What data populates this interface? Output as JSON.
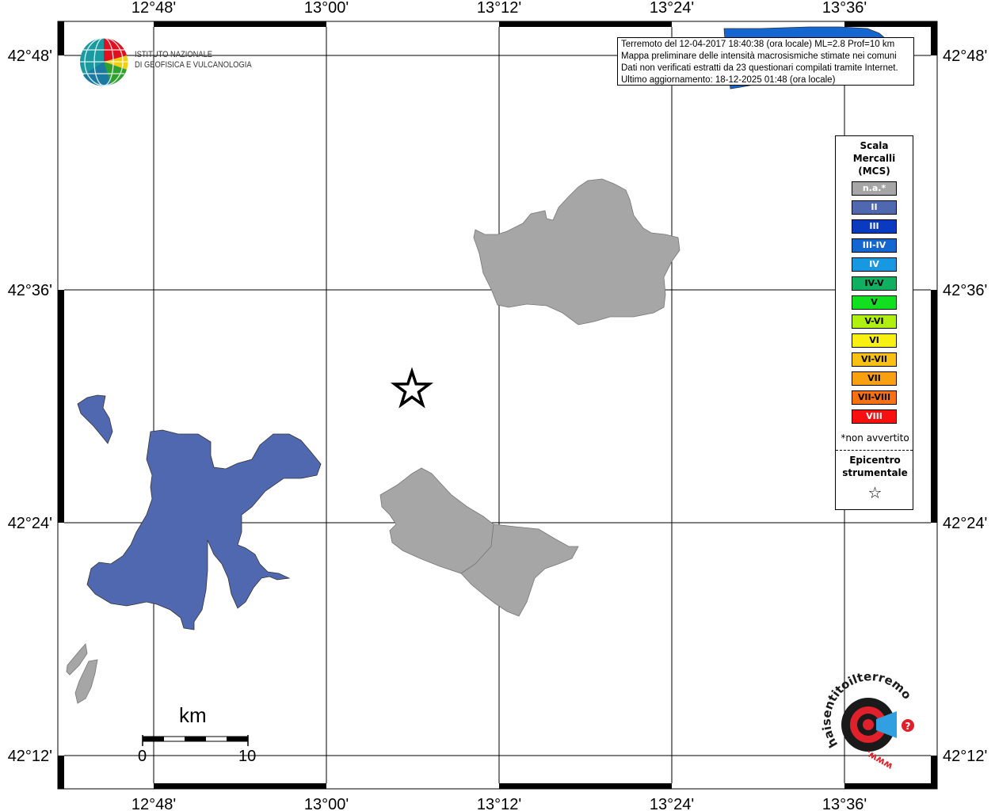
{
  "map": {
    "lon_ticks": [
      "12°48'",
      "13°00'",
      "13°12'",
      "13°24'",
      "13°36'"
    ],
    "lat_ticks": [
      "42°48'",
      "42°36'",
      "42°24'",
      "42°12'"
    ]
  },
  "info": {
    "line1": "Terremoto del 12-04-2017 18:40:38 (ora locale) ML=2.8 Prof=10 km",
    "line2": "Mappa preliminare delle intensità macrosismiche stimate nei comuni",
    "line3": "Dati non verificati estratti da 23 questionari compilati tramite Internet.",
    "line4": "Ultimo aggiornamento: 18-12-2025 01:48 (ora locale)"
  },
  "logo": {
    "line1": "ISTITUTO NAZIONALE",
    "line2": "DI GEOFISICA E VULCANOLOGIA",
    "hst_text": "haisentitoilterremoto.it",
    "hst_www": "www."
  },
  "legend": {
    "title1": "Scala",
    "title2": "Mercalli",
    "title3": "(MCS)",
    "items": [
      {
        "label": "n.a.*",
        "color": "#a6a6a6"
      },
      {
        "label": "II",
        "color": "#5068b0"
      },
      {
        "label": "III",
        "color": "#0a3ac0"
      },
      {
        "label": "III-IV",
        "color": "#1466d0"
      },
      {
        "label": "IV",
        "color": "#1898e0"
      },
      {
        "label": "IV-V",
        "color": "#10b060"
      },
      {
        "label": "V",
        "color": "#10e020"
      },
      {
        "label": "V-VI",
        "color": "#b0f010"
      },
      {
        "label": "VI",
        "color": "#f8f010"
      },
      {
        "label": "VI-VII",
        "color": "#f8c010"
      },
      {
        "label": "VII",
        "color": "#f8a010"
      },
      {
        "label": "VII-VIII",
        "color": "#f87010"
      },
      {
        "label": "VIII",
        "color": "#f81010"
      }
    ],
    "note": "*non avvertito",
    "epi1": "Epicentro",
    "epi2": "strumentale",
    "star": "☆"
  },
  "scale": {
    "title": "km",
    "start": "0",
    "end": "10"
  },
  "colors": {
    "na": "#a6a6a6",
    "ii": "#5068b0",
    "iii_iv": "#1466d0"
  }
}
